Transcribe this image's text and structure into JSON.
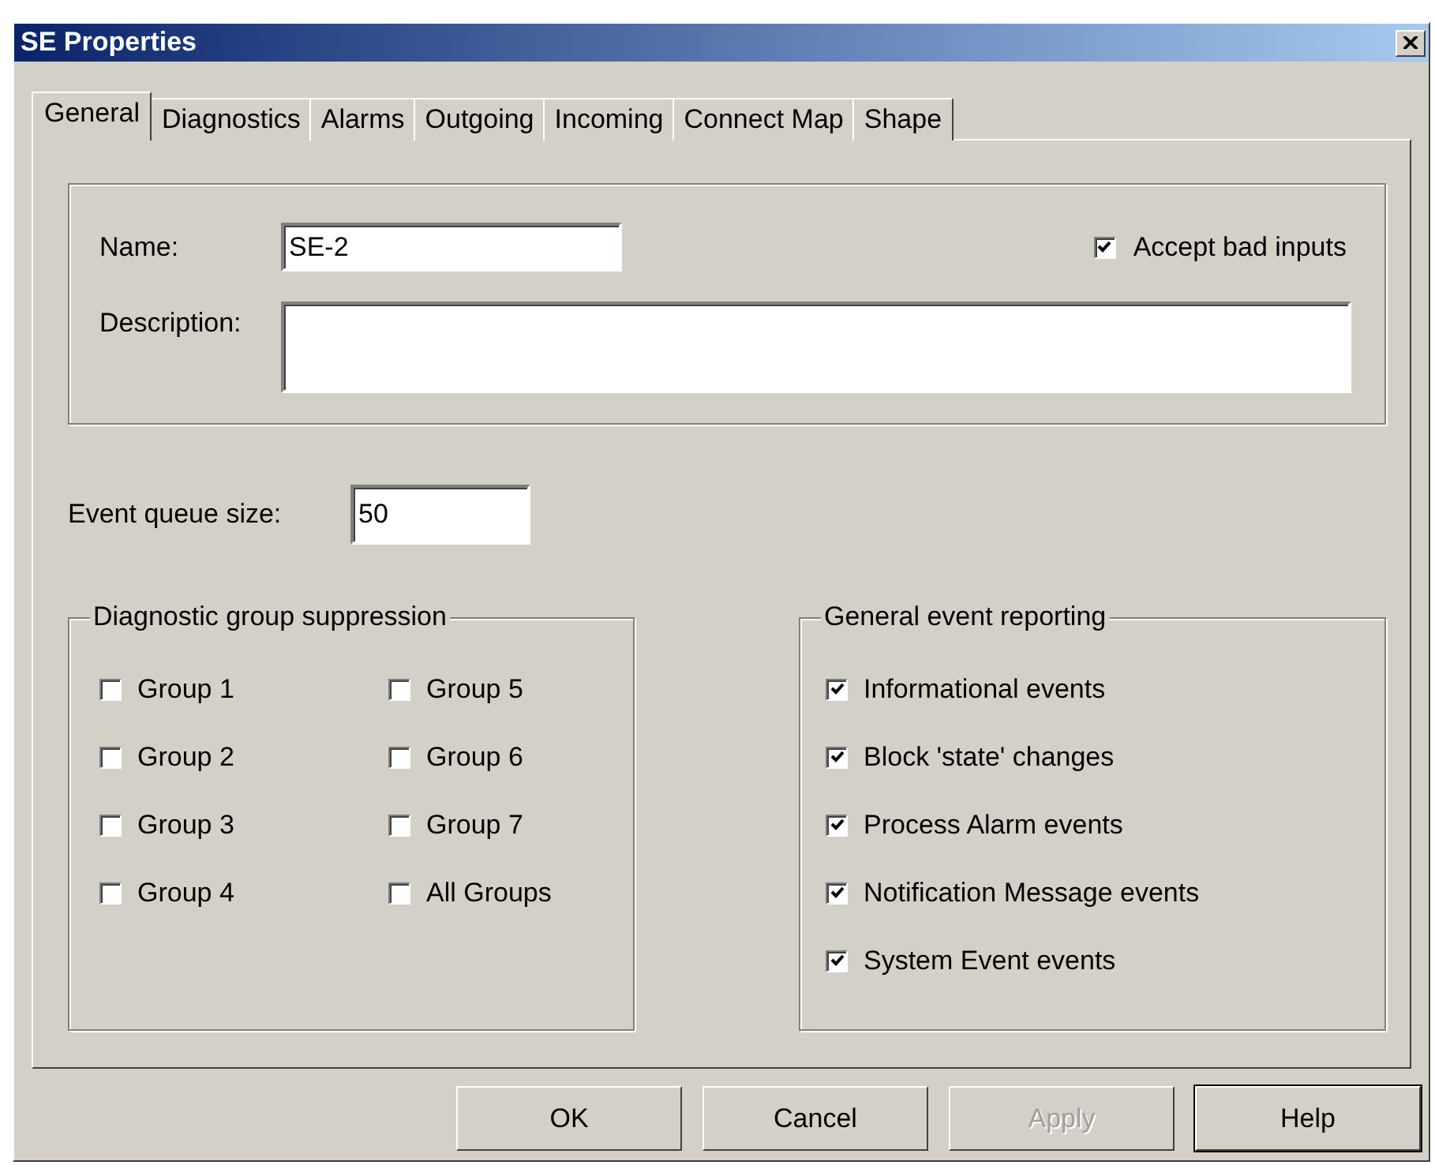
{
  "window": {
    "title": "SE Properties"
  },
  "tabs": [
    {
      "label": "General",
      "selected": true
    },
    {
      "label": "Diagnostics",
      "selected": false
    },
    {
      "label": "Alarms",
      "selected": false
    },
    {
      "label": "Outgoing",
      "selected": false
    },
    {
      "label": "Incoming",
      "selected": false
    },
    {
      "label": "Connect Map",
      "selected": false
    },
    {
      "label": "Shape",
      "selected": false
    }
  ],
  "identity": {
    "name_label": "Name:",
    "name_value": "SE-2",
    "accept_bad_inputs": {
      "label": "Accept bad inputs",
      "checked": true
    },
    "description_label": "Description:"
  },
  "event_queue": {
    "label": "Event queue size:",
    "value": "50"
  },
  "diagnostic_group_suppression": {
    "title": "Diagnostic group suppression",
    "items": [
      {
        "label": "Group 1",
        "checked": false
      },
      {
        "label": "Group 2",
        "checked": false
      },
      {
        "label": "Group 3",
        "checked": false
      },
      {
        "label": "Group 4",
        "checked": false
      },
      {
        "label": "Group 5",
        "checked": false
      },
      {
        "label": "Group 6",
        "checked": false
      },
      {
        "label": "Group 7",
        "checked": false
      },
      {
        "label": "All Groups",
        "checked": false
      }
    ]
  },
  "general_event_reporting": {
    "title": "General event reporting",
    "items": [
      {
        "label": "Informational events",
        "checked": true
      },
      {
        "label": "Block 'state' changes",
        "checked": true
      },
      {
        "label": "Process Alarm events",
        "checked": true
      },
      {
        "label": "Notification Message events",
        "checked": true
      },
      {
        "label": "System Event events",
        "checked": true
      }
    ]
  },
  "buttons": [
    {
      "label": "OK",
      "disabled": false,
      "default": false
    },
    {
      "label": "Cancel",
      "disabled": false,
      "default": false
    },
    {
      "label": "Apply",
      "disabled": true,
      "default": false
    },
    {
      "label": "Help",
      "disabled": false,
      "default": true
    }
  ]
}
